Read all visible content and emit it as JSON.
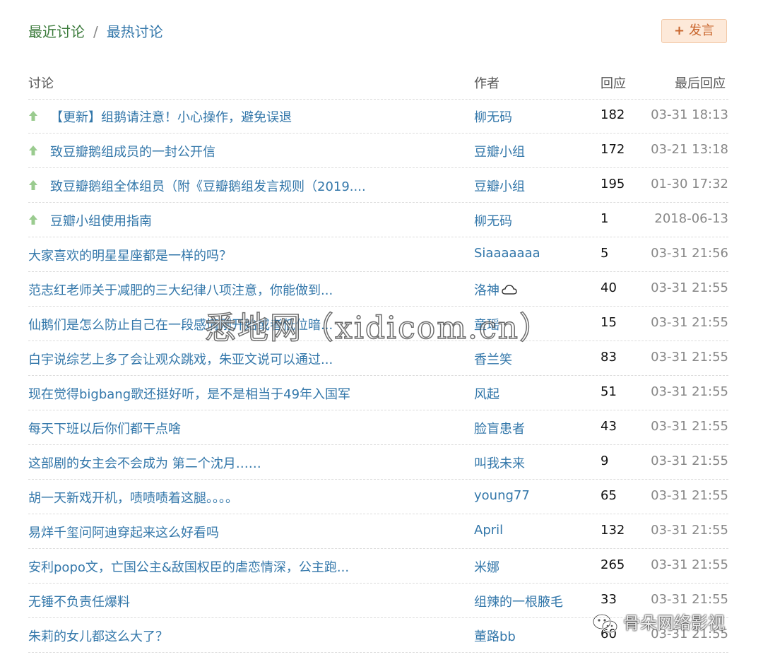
{
  "tabs": {
    "recent": "最近讨论",
    "separator": "/",
    "hot": "最热讨论"
  },
  "post_button": {
    "plus": "+",
    "label": "发言"
  },
  "table": {
    "headers": {
      "topic": "讨论",
      "author": "作者",
      "replies": "回应",
      "last_reply": "最后回应"
    },
    "rows": [
      {
        "pinned": true,
        "title": "【更新】组鹅请注意！小心操作，避免误退",
        "author": "柳无码",
        "author_linked": false,
        "replies": "182",
        "last_reply": "03-31 18:13"
      },
      {
        "pinned": true,
        "title": "致豆瓣鹅组成员的一封公开信",
        "author": "豆瓣小组",
        "author_linked": true,
        "replies": "172",
        "last_reply": "03-21 13:18"
      },
      {
        "pinned": true,
        "title": "致豆瓣鹅组全体组员（附《豆瓣鹅组发言规则（2019....",
        "author": "豆瓣小组",
        "author_linked": true,
        "replies": "195",
        "last_reply": "01-30 17:32"
      },
      {
        "pinned": true,
        "title": "豆瓣小组使用指南",
        "author": "柳无码",
        "author_linked": false,
        "replies": "1",
        "last_reply": "2018-06-13"
      },
      {
        "pinned": false,
        "title": "大家喜欢的明星星座都是一样的吗？",
        "author": "Siaaaaaaa",
        "author_linked": true,
        "replies": "5",
        "last_reply": "03-31 21:56"
      },
      {
        "pinned": false,
        "title": "范志红老师关于减肥的三大纪律八项注意，你能做到...",
        "author": "洛神",
        "author_linked": false,
        "author_icon": "cloud-icon",
        "replies": "40",
        "last_reply": "03-31 21:55"
      },
      {
        "pinned": false,
        "title": "仙鹅们是怎么防止自己在一段感情刚开始或者低位暗...",
        "author": "童瑶",
        "author_linked": false,
        "replies": "15",
        "last_reply": "03-31 21:55"
      },
      {
        "pinned": false,
        "title": "白宇说综艺上多了会让观众跳戏，朱亚文说可以通过...",
        "author": "香兰笑",
        "author_linked": false,
        "replies": "83",
        "last_reply": "03-31 21:55"
      },
      {
        "pinned": false,
        "title": "现在觉得bigbang歌还挺好听，是不是相当于49年入国军",
        "author": "风起",
        "author_linked": false,
        "replies": "51",
        "last_reply": "03-31 21:55"
      },
      {
        "pinned": false,
        "title": "每天下班以后你们都干点啥",
        "author": "脸盲患者",
        "author_linked": false,
        "replies": "43",
        "last_reply": "03-31 21:55"
      },
      {
        "pinned": false,
        "title": "这部剧的女主会不会成为 第二个沈月……",
        "author": "叫我未来",
        "author_linked": false,
        "replies": "9",
        "last_reply": "03-31 21:55"
      },
      {
        "pinned": false,
        "title": "胡一天新戏开机，啧啧啧着这腿。。。。",
        "author": "young77",
        "author_linked": true,
        "replies": "65",
        "last_reply": "03-31 21:55"
      },
      {
        "pinned": false,
        "title": "易烊千玺问阿迪穿起来这么好看吗",
        "author": "April",
        "author_linked": true,
        "replies": "132",
        "last_reply": "03-31 21:55"
      },
      {
        "pinned": false,
        "title": "安利popo文，亡国公主&敌国权臣的虐恋情深，公主跑...",
        "author": "米娜",
        "author_linked": false,
        "replies": "265",
        "last_reply": "03-31 21:55"
      },
      {
        "pinned": false,
        "title": "无锤不负责任爆料",
        "author": "组辣的一根腋毛",
        "author_linked": false,
        "replies": "33",
        "last_reply": "03-31 21:55"
      },
      {
        "pinned": false,
        "title": "朱莉的女儿都这么大了？",
        "author": "董路bb",
        "author_linked": true,
        "replies": "60",
        "last_reply": "03-31 21:55"
      }
    ]
  },
  "overlays": {
    "watermark": "悉地网（xidicom.cn）",
    "wechat_account": "骨朵网络影视"
  },
  "colors": {
    "link": "#3377aa",
    "active_tab": "#3a7a3a",
    "pin_arrow": "#9acb8f",
    "button_bg": "#fde9d9",
    "button_text": "#c9662e",
    "muted": "#888888"
  }
}
